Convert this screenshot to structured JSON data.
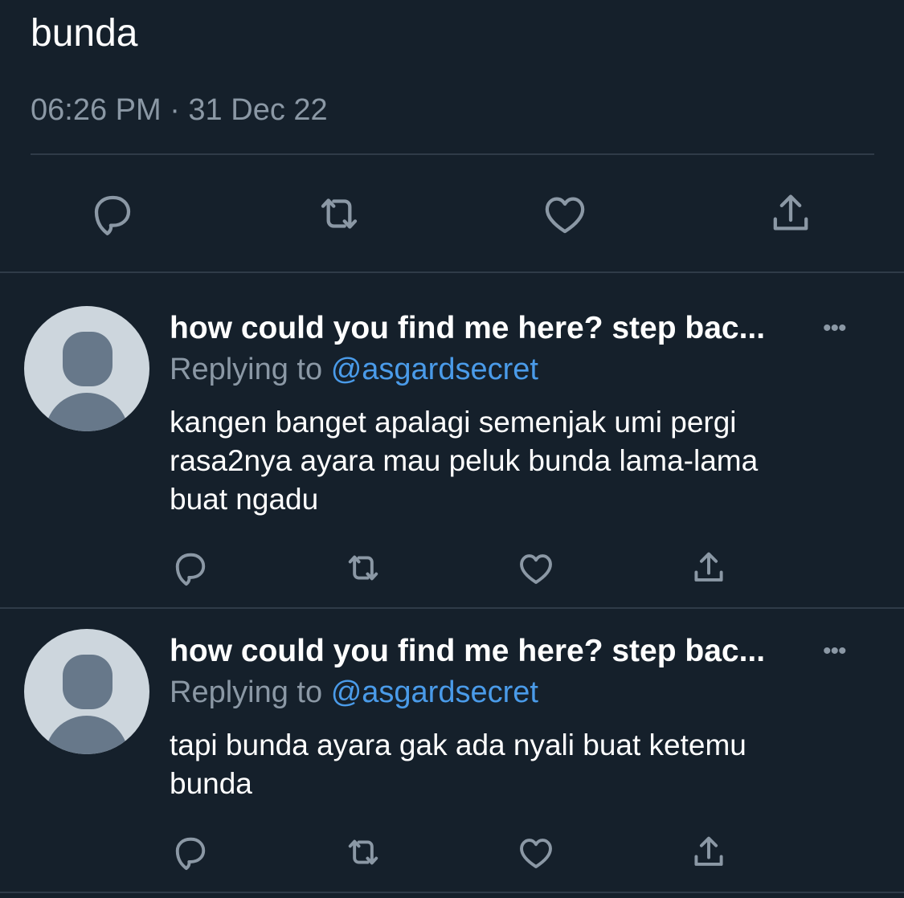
{
  "main_tweet": {
    "text": "bunda",
    "timestamp": "06:26 PM · 31 Dec 22",
    "actions": [
      {
        "icon": "reply-icon"
      },
      {
        "icon": "retweet-icon"
      },
      {
        "icon": "like-icon"
      },
      {
        "icon": "share-icon"
      }
    ]
  },
  "replies": [
    {
      "display_name": "how could you find me here? step bac...",
      "replying_label": "Replying to",
      "replying_handle": "@asgardsecret",
      "text": "kangen banget apalagi semenjak umi pergi\nrasa2nya ayara mau peluk bunda lama-lama\nbuat ngadu",
      "more_icon": "ellipsis-icon"
    },
    {
      "display_name": "how could you find me here? step bac...",
      "replying_label": "Replying to",
      "replying_handle": "@asgardsecret",
      "text": "tapi bunda ayara gak ada nyali buat ketemu\nbunda",
      "more_icon": "ellipsis-icon"
    }
  ],
  "colors": {
    "background": "#15202b",
    "text": "#ffffff",
    "secondary_text": "#8b98a5",
    "link": "#4a9be9",
    "divider": "#2f3b48",
    "avatar_bg": "#cdd6dd",
    "avatar_fg": "#67788a"
  }
}
